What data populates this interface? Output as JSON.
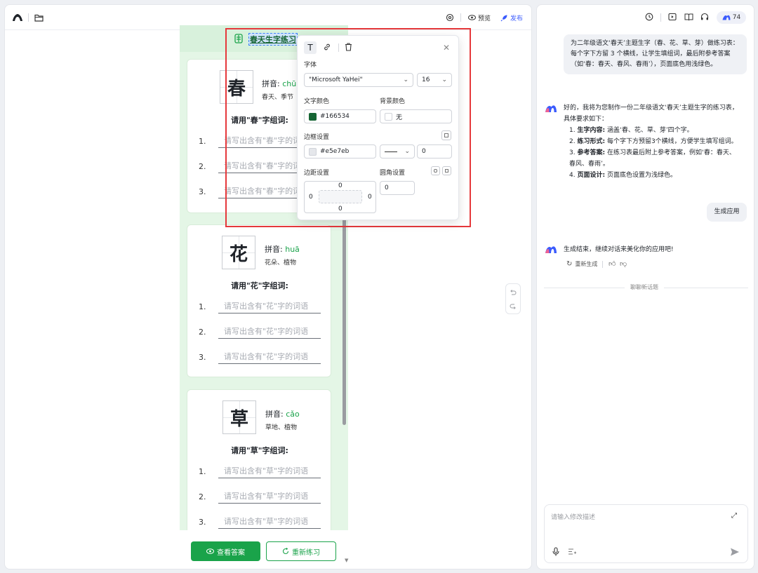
{
  "editor_toolbar": {
    "preview_label": "预览",
    "publish_label": "发布"
  },
  "worksheet": {
    "title": "春天生字练习",
    "pinyin_label": "拼音:",
    "placeholder_prefix": "请写出含有",
    "cards": [
      {
        "char": "春",
        "pinyin": "chūn",
        "words": "春天、季节",
        "prompt": "请用\"春\"字组词:",
        "placeholder": "请写出含有\"春\"字的词语"
      },
      {
        "char": "花",
        "pinyin": "huā",
        "words": "花朵、植物",
        "prompt": "请用\"花\"字组词:",
        "placeholder": "请写出含有\"花\"字的词语"
      },
      {
        "char": "草",
        "pinyin": "cǎo",
        "words": "草地、植物",
        "prompt": "请用\"草\"字组词:",
        "placeholder": "请写出含有\"草\"字的词语"
      }
    ],
    "line_numbers": [
      "1.",
      "2.",
      "3."
    ],
    "view_answers_label": "查看答案",
    "redo_practice_label": "重新练习"
  },
  "style_popover": {
    "font_label": "字体",
    "font_family": "\"Microsoft YaHei\"",
    "font_size": "16",
    "text_color_label": "文字颜色",
    "text_color_value": "#166534",
    "bg_color_label": "背景颜色",
    "bg_color_value": "无",
    "border_label": "边框设置",
    "border_color_value": "#e5e7eb",
    "border_width": "0",
    "padding_label": "边距设置",
    "padding_top": "0",
    "padding_left": "0",
    "padding_right": "0",
    "padding_bottom": "0",
    "radius_label": "圆角设置",
    "radius_value": "0",
    "colors": {
      "text_swatch": "#166534",
      "border_swatch": "#e5e7eb"
    }
  },
  "chat": {
    "credits": "74",
    "user_message_1": "为二年级语文‘春天’主题生字（春、花、草、芽）做练习表：每个字下方留 3 个横线，让学生填组词，最后附参考答案（如‘春：春天、春风、春雨’），页面底色用浅绿色。",
    "ai_intro": "好的，我将为您制作一份二年级语文‘春天’主题生字的练习表，具体要求如下：",
    "ai_points": [
      {
        "num": "1.",
        "title": "生字内容:",
        "text": "涵盖‘春、花、草、芽’四个字。"
      },
      {
        "num": "2.",
        "title": "练习形式:",
        "text": "每个字下方预留3个横线，方便学生填写组词。"
      },
      {
        "num": "3.",
        "title": "参考答案:",
        "text": "在练习表最后附上参考答案，例如‘春：春天、春风、春雨’。"
      },
      {
        "num": "4.",
        "title": "页面设计:",
        "text": "页面底色设置为浅绿色。"
      }
    ],
    "user_message_2": "生成应用",
    "ai_done": "生成结束，继续对话来美化你的应用吧!",
    "regenerate_label": "重新生成",
    "new_topic_label": "聊聊新话题",
    "input_placeholder": "请输入修改描述"
  },
  "colors": {
    "accent_green": "#1aa34a",
    "selection_red": "#e5383b",
    "brand_blue": "#3b5bfd"
  }
}
